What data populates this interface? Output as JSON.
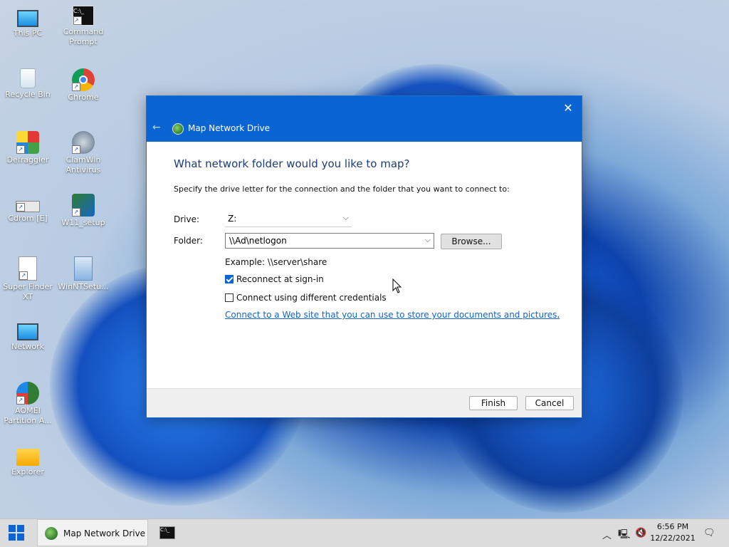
{
  "desktop": {
    "icons": [
      {
        "label": "This PC"
      },
      {
        "label": "Command Prompt"
      },
      {
        "label": "Recycle Bin"
      },
      {
        "label": "Chrome"
      },
      {
        "label": "Defraggler"
      },
      {
        "label": "ClamWin Antivirus"
      },
      {
        "label": "Cdrom [E]"
      },
      {
        "label": "W11_setup"
      },
      {
        "label": "Super Finder XT"
      },
      {
        "label": "WinNTSetu..."
      },
      {
        "label": "Network"
      },
      {
        "label": "AOMEI Partition A..."
      },
      {
        "label": "Explorer"
      }
    ]
  },
  "dialog": {
    "title": "Map Network Drive",
    "back_icon": "back-arrow",
    "close_icon": "close-x",
    "heading": "What network folder would you like to map?",
    "instruction": "Specify the drive letter for the connection and the folder that you want to connect to:",
    "drive_label": "Drive:",
    "drive_value": "Z:",
    "folder_label": "Folder:",
    "folder_value": "\\\\Ad\\netlogon",
    "browse_label": "Browse...",
    "example": "Example: \\\\server\\share",
    "reconnect_label": "Reconnect at sign-in",
    "reconnect_checked": true,
    "credentials_label": "Connect using different credentials",
    "credentials_checked": false,
    "web_link": "Connect to a Web site that you can use to store your documents and pictures",
    "web_link_suffix": ".",
    "finish_label": "Finish",
    "cancel_label": "Cancel",
    "accent_color": "#0a64d2"
  },
  "taskbar": {
    "active_app": "Map Network Drive",
    "time": "6:56 PM",
    "date": "12/22/2021"
  }
}
